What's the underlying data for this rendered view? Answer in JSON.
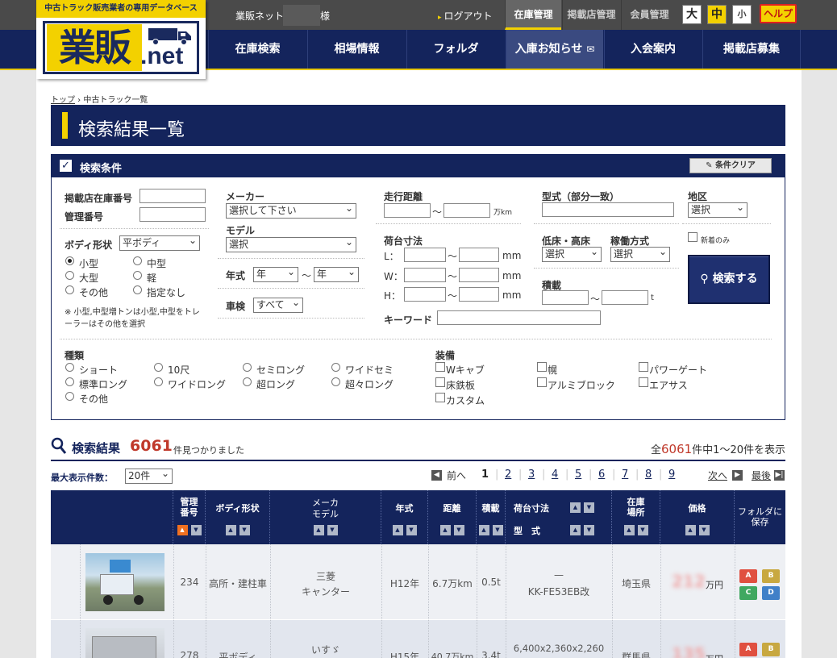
{
  "header": {
    "tagline": "中古トラック販売業者の専用データベース",
    "logo_text": "業販",
    "logo_suffix": ".net",
    "user_prefix": "業販ネット",
    "user_suffix": "様",
    "logout": "ログアウト",
    "tabs": [
      "在庫管理",
      "掲載店管理",
      "会員管理"
    ],
    "font_sizes": [
      "大",
      "中",
      "小"
    ],
    "help": "ヘルプ"
  },
  "nav": [
    "在庫検索",
    "相場情報",
    "フォルダ",
    "入庫お知らせ",
    "入会案内",
    "掲載店募集"
  ],
  "breadcrumb": {
    "home": "トップ",
    "current": "中古トラック一覧"
  },
  "page_title": "検索結果一覧",
  "search": {
    "title": "検索条件",
    "clear": "条件クリア",
    "stock_no_label": "掲載店在庫番号",
    "mgmt_no_label": "管理番号",
    "body_label": "ボディ形状",
    "body_value": "平ボディ",
    "size_options": [
      "小型",
      "中型",
      "大型",
      "軽",
      "その他",
      "指定なし"
    ],
    "size_note": "※ 小型,中型増トンは小型,中型をトレーラーはその他を選択",
    "maker_label": "メーカー",
    "maker_value": "選択して下さい",
    "model_label": "モデル",
    "model_value": "選択",
    "year_label": "年式",
    "year_from": "年",
    "year_to": "年",
    "inspection_label": "車検",
    "inspection_value": "すべて",
    "mileage_label": "走行距離",
    "mileage_unit": "万km",
    "bed_label": "荷台寸法",
    "bed_dims": [
      "L：",
      "W：",
      "H："
    ],
    "bed_unit": "mm",
    "keyword_label": "キーワード",
    "type_label": "型式（部分一致）",
    "floor_label": "低床・高床",
    "floor_value": "選択",
    "drive_label": "稼働方式",
    "drive_value": "選択",
    "load_label": "積載",
    "load_unit": "t",
    "region_label": "地区",
    "region_value": "選択",
    "new_only": "新着のみ",
    "search_button": "検索する",
    "kind_label": "種類",
    "kinds": [
      "ショート",
      "10尺",
      "セミロング",
      "ワイドセミ",
      "標準ロング",
      "ワイドロング",
      "超ロング",
      "超々ロング",
      "その他"
    ],
    "equip_label": "装備",
    "equips": [
      "Wキャブ",
      "幌",
      "パワーゲート",
      "床鉄板",
      "アルミブロック",
      "エアサス",
      "カスタム"
    ],
    "range_sep": "～"
  },
  "results": {
    "title": "検索結果",
    "count": "6061",
    "found_suffix": "件見つかりました",
    "total_prefix": "全",
    "total": "6061",
    "range_text": "件中1～20件を表示",
    "per_page_label": "最大表示件数：",
    "per_page_value": "20件",
    "prev": "前へ",
    "pages": [
      "1",
      "2",
      "3",
      "4",
      "5",
      "6",
      "7",
      "8",
      "9"
    ],
    "next": "次へ",
    "last": "最後"
  },
  "table": {
    "headers": {
      "mgmt": "管理番号",
      "body": "ボディ形状",
      "maker": "メーカ",
      "model": "モデル",
      "year": "年式",
      "mileage": "距離",
      "load": "積載",
      "bed": "荷台寸法",
      "type": "型　式",
      "location": "在庫場所",
      "price": "価格",
      "folder": "フォルダに保存"
    },
    "rows": [
      {
        "mgmt": "234",
        "body": "高所・建柱車",
        "maker": "三菱",
        "model": "キャンター",
        "year": "H12年",
        "mileage": "6.7万km",
        "load": "0.5t",
        "bed": "—",
        "type": "KK-FE53EB改",
        "location": "埼玉県",
        "price": "212",
        "price_unit": "万円"
      },
      {
        "mgmt": "278",
        "body": "平ボディ",
        "maker": "いすゞ",
        "model": "",
        "year": "H15年",
        "mileage": "40.7万km",
        "load": "3.4t",
        "bed": "6,400x2,360x2,260",
        "type": "",
        "location": "群馬県",
        "price": "135",
        "price_unit": "万円"
      }
    ],
    "folders": [
      "A",
      "B",
      "C",
      "D"
    ]
  }
}
